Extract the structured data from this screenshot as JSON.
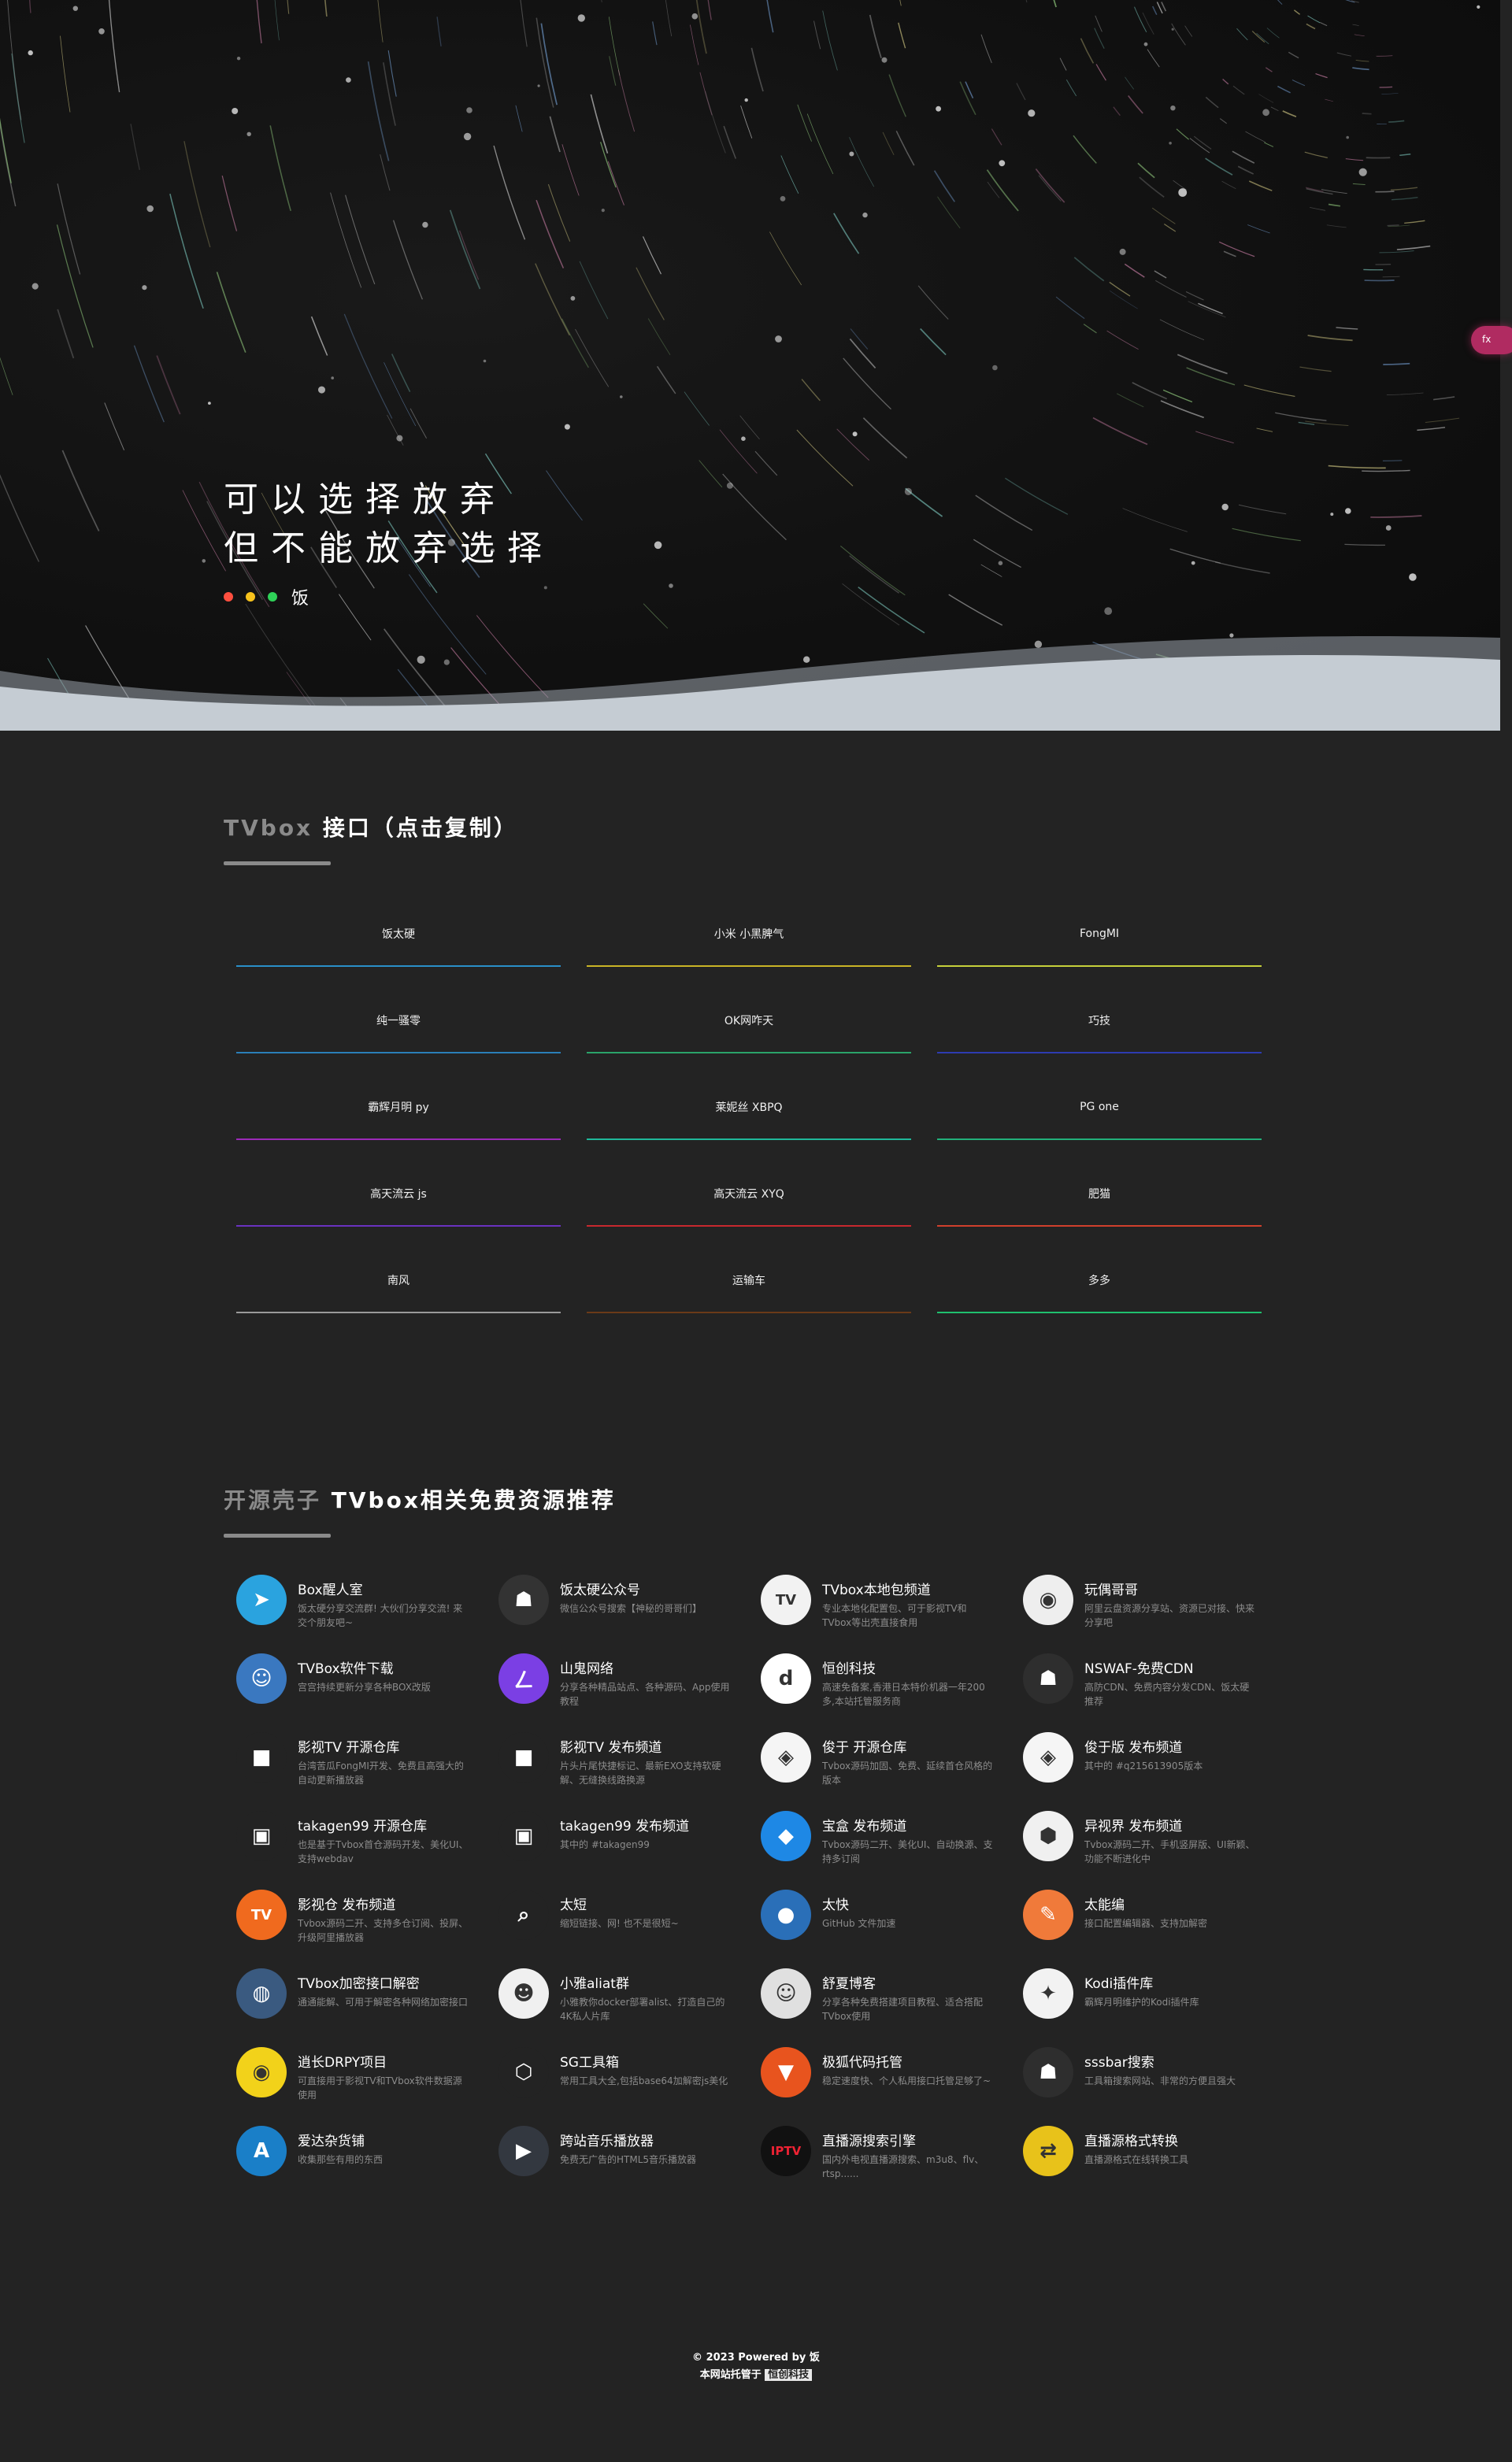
{
  "hero": {
    "line1": "可以选择放弃",
    "line2": "但不能放弃选择",
    "author": "饭",
    "side_label": "fx"
  },
  "tvbox_section": {
    "title_prefix": "TVbox",
    "title_main": " 接口（点击复制）",
    "items": [
      {
        "label": "饭太硬",
        "color": "#2a8fc8"
      },
      {
        "label": "小米 小黑脾气",
        "color": "#c9b426"
      },
      {
        "label": "FongMI",
        "color": "#c6d03a"
      },
      {
        "label": "纯一骚零",
        "color": "#2a7fb8"
      },
      {
        "label": "OK网咋天",
        "color": "#2aa36a"
      },
      {
        "label": "巧技",
        "color": "#2d3bb0"
      },
      {
        "label": "霸辉月明 py",
        "color": "#9b2ab8"
      },
      {
        "label": "莱妮丝 XBPQ",
        "color": "#1fb89a"
      },
      {
        "label": "PG one",
        "color": "#22b07a"
      },
      {
        "label": "高天流云 js",
        "color": "#6a32c0"
      },
      {
        "label": "高天流云 XYQ",
        "color": "#c8282e"
      },
      {
        "label": "肥猫",
        "color": "#d0402c"
      },
      {
        "label": "南风",
        "color": "#9a9a9a"
      },
      {
        "label": "运输车",
        "color": "#6a3a18"
      },
      {
        "label": "多多",
        "color": "#1fc06e"
      }
    ]
  },
  "resources_section": {
    "title_prefix": "开源壳子",
    "title_main": " TVbox相关免费资源推荐",
    "items": [
      {
        "title": "Box醒人室",
        "desc": "饭太硬分享交流群! 大伙们分享交流! 来交个朋友吧~",
        "icon": "telegram-icon",
        "bg": "#2aa3df",
        "glyph": "➤"
      },
      {
        "title": "饭太硬公众号",
        "desc": "微信公众号搜索【神秘的哥哥们】",
        "icon": "wechat-account-icon",
        "bg": "#333333",
        "glyph": "☗"
      },
      {
        "title": "TVbox本地包频道",
        "desc": "专业本地化配置包、可于影视TV和TVbox等出壳直接食用",
        "icon": "tvfan-icon",
        "bg": "#f2f2f2",
        "glyph": "TV"
      },
      {
        "title": "玩偶哥哥",
        "desc": "阿里云盘资源分享站、资源已对接、快来分享吧",
        "icon": "ninja-icon",
        "bg": "#eeeeee",
        "glyph": "◉"
      },
      {
        "title": "TVBox软件下载",
        "desc": "宫宫持续更新分享各种BOX改版",
        "icon": "anime-avatar-icon",
        "bg": "#3a78c0",
        "glyph": "☺"
      },
      {
        "title": "山鬼网络",
        "desc": "分享各种精品站点、各种源码、App使用教程",
        "icon": "shangui-icon",
        "bg": "#7b3fe4",
        "glyph": "ㄥ"
      },
      {
        "title": "恒创科技",
        "desc": "高速免备案,香港日本特价机器一年200多,本站托管服务商",
        "icon": "hengchuang-icon",
        "bg": "#ffffff",
        "glyph": "d"
      },
      {
        "title": "NSWAF-免费CDN",
        "desc": "高防CDN、免费内容分发CDN、饭太硬推荐",
        "icon": "nswaf-icon",
        "bg": "#2e2e2e",
        "glyph": "☗"
      },
      {
        "title": "影视TV 开源仓库",
        "desc": "台湾苦瓜FongMI开发、免费且高强大的自动更新播放器",
        "icon": "cube-icon",
        "bg": "#232323",
        "glyph": "■"
      },
      {
        "title": "影视TV 发布频道",
        "desc": "片头片尾快捷标记、最新EXO支持软硬解、无缝换线路换源",
        "icon": "cube-icon",
        "bg": "#232323",
        "glyph": "■"
      },
      {
        "title": "俊于 开源仓库",
        "desc": "Tvbox源码加固、免费、延续首仓风格的版本",
        "icon": "cube-blue-icon",
        "bg": "#f5f5f5",
        "glyph": "◈"
      },
      {
        "title": "俊于版 发布频道",
        "desc": "其中的 #q215613905版本",
        "icon": "cube-blue-icon",
        "bg": "#f5f5f5",
        "glyph": "◈"
      },
      {
        "title": "takagen99 开源仓库",
        "desc": "也是基于Tvbox首仓源码开发、美化UI、支持webdav",
        "icon": "box-icon",
        "bg": "#232323",
        "glyph": "▣"
      },
      {
        "title": "takagen99 发布频道",
        "desc": "其中的 #takagen99",
        "icon": "box-icon",
        "bg": "#232323",
        "glyph": "▣"
      },
      {
        "title": "宝盒 发布频道",
        "desc": "Tvbox源码二开、美化UI、自动换源、支持多订阅",
        "icon": "box-blue-icon",
        "bg": "#1e88e5",
        "glyph": "◆"
      },
      {
        "title": "异视界 发布频道",
        "desc": "Tvbox源码二开、手机竖屏版、UI新颖、功能不断进化中",
        "icon": "cube-gray-icon",
        "bg": "#f0f0f0",
        "glyph": "⬢"
      },
      {
        "title": "影视仓 发布频道",
        "desc": "Tvbox源码二开、支持多仓订阅、投屏、升级阿里播放器",
        "icon": "tv-orange-icon",
        "bg": "#f06a1e",
        "glyph": "TV"
      },
      {
        "title": "太短",
        "desc": "缩短链接、网! 也不是很短~",
        "icon": "search-link-icon",
        "bg": "#232323",
        "glyph": "⌕"
      },
      {
        "title": "太快",
        "desc": "GitHub 文件加速",
        "icon": "github-icon",
        "bg": "#2a6fb8",
        "glyph": "●"
      },
      {
        "title": "太能编",
        "desc": "接口配置编辑器、支持加解密",
        "icon": "editor-icon",
        "bg": "#f07a3a",
        "glyph": "✎"
      },
      {
        "title": "TVbox加密接口解密",
        "desc": "通通能解、可用于解密各种网络加密接口",
        "icon": "globe-icon",
        "bg": "#3a5a80",
        "glyph": "◍"
      },
      {
        "title": "小雅aliat群",
        "desc": "小雅教你docker部署alist、打造自己的4K私人片库",
        "icon": "xiaoya-icon",
        "bg": "#f0f0f0",
        "glyph": "☻"
      },
      {
        "title": "舒夏博客",
        "desc": "分享各种免费搭建项目教程、适合搭配TVbox使用",
        "icon": "astronaut-icon",
        "bg": "#e0e0e0",
        "glyph": "☺"
      },
      {
        "title": "Kodi插件库",
        "desc": "霸辉月明维护的Kodi插件库",
        "icon": "kodi-icon",
        "bg": "#f2f2f2",
        "glyph": "✦"
      },
      {
        "title": "逍长DRPY项目",
        "desc": "可直接用于影视TV和TVbox软件数据源使用",
        "icon": "drpy-icon",
        "bg": "#f2d21a",
        "glyph": "◉"
      },
      {
        "title": "SG工具箱",
        "desc": "常用工具大全,包括base64加解密js美化",
        "icon": "sg-tools-icon",
        "bg": "#232323",
        "glyph": "⬡"
      },
      {
        "title": "极狐代码托管",
        "desc": "稳定速度快、个人私用接口托管足够了~",
        "icon": "gitlab-icon",
        "bg": "#e8541e",
        "glyph": "▼"
      },
      {
        "title": "sssbar搜索",
        "desc": "工具箱搜索网站、非常的方便且强大",
        "icon": "sssbar-icon",
        "bg": "#2e2e2e",
        "glyph": "☗"
      },
      {
        "title": "爱达杂货铺",
        "desc": "收集那些有用的东西",
        "icon": "letter-a-icon",
        "bg": "#1a7fc8",
        "glyph": "A"
      },
      {
        "title": "跨站音乐播放器",
        "desc": "免费无广告的HTML5音乐播放器",
        "icon": "play-icon",
        "bg": "#333840",
        "glyph": "▶"
      },
      {
        "title": "直播源搜索引擎",
        "desc": "国内外电视直播源搜索、m3u8、flv、rtsp......",
        "icon": "iptv-icon",
        "bg": "#111111",
        "glyph": "IPTV"
      },
      {
        "title": "直播源格式转换",
        "desc": "直播源格式在线转换工具",
        "icon": "convert-icon",
        "bg": "#e8c21a",
        "glyph": "⇄"
      }
    ]
  },
  "footer": {
    "copyright": "© 2023 Powered by 饭",
    "host_prefix": "本网站托管于 ",
    "host_name": "恒创科技"
  }
}
